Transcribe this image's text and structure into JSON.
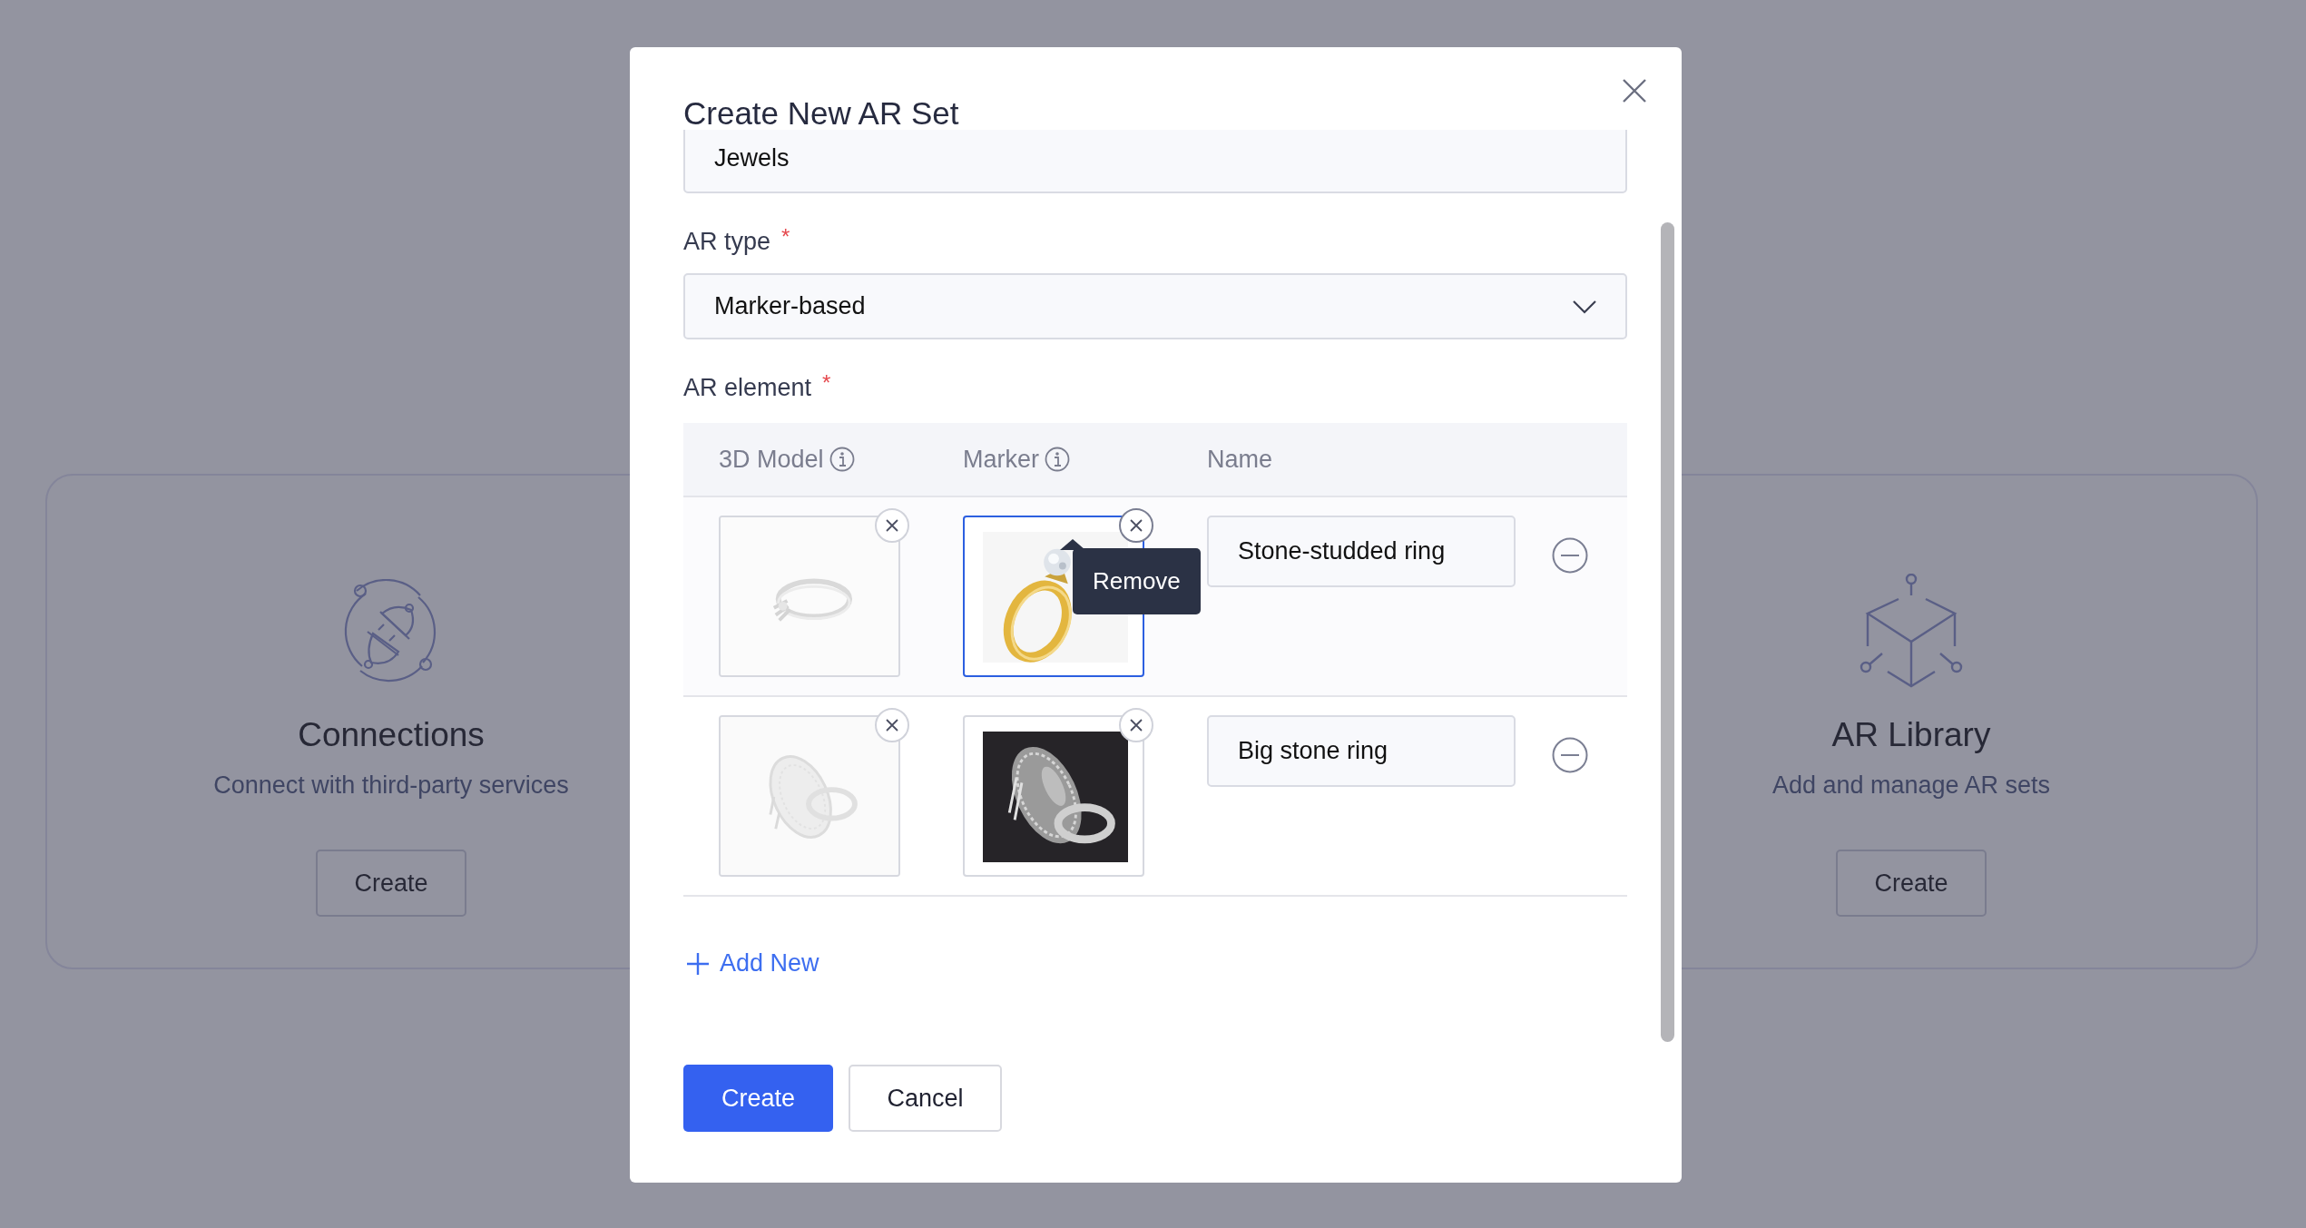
{
  "background_cards": [
    {
      "title": "Connections",
      "description": "Connect with third-party services",
      "button": "Create"
    },
    {
      "title": "AR Library",
      "description": "Add and manage AR sets",
      "button": "Create"
    }
  ],
  "dialog": {
    "title": "Create New AR Set",
    "name_value": "Jewels",
    "ar_type": {
      "label": "AR type",
      "required_mark": "*",
      "value": "Marker-based"
    },
    "ar_element": {
      "label": "AR element",
      "required_mark": "*"
    },
    "columns": [
      {
        "label": "3D Model",
        "info": true
      },
      {
        "label": "Marker",
        "info": true
      },
      {
        "label": "Name"
      }
    ],
    "rows": [
      {
        "marker": {
          "kind": "picture",
          "selected": true,
          "tooltip": "Remove"
        },
        "name": "Stone-studded ring"
      },
      {
        "name": "Big stone ring"
      }
    ],
    "add_button": "Add New",
    "buttons": [
      {
        "label": "Create",
        "kind": "primary"
      },
      {
        "label": "Cancel",
        "kind": "secondary"
      }
    ]
  }
}
